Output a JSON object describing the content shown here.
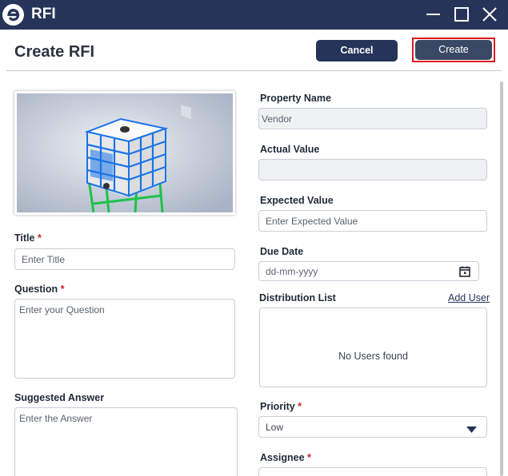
{
  "window": {
    "title": "RFI",
    "logo_icon": "e-logo-icon",
    "controls": [
      "minimize-icon",
      "maximize-icon",
      "close-icon"
    ]
  },
  "header": {
    "page_title": "Create RFI",
    "cancel_label": "Cancel",
    "create_label": "Create"
  },
  "left": {
    "title": {
      "label": "Title",
      "required": "*",
      "placeholder": "Enter Title"
    },
    "question": {
      "label": "Question",
      "required": "*",
      "placeholder": "Enter your Question"
    },
    "suggested_answer": {
      "label": "Suggested Answer",
      "placeholder": "Enter the Answer"
    }
  },
  "right": {
    "property_name": {
      "label": "Property Name",
      "value": "Vendor"
    },
    "actual_value": {
      "label": "Actual Value",
      "value": ""
    },
    "expected_value": {
      "label": "Expected Value",
      "placeholder": "Enter Expected Value"
    },
    "due_date": {
      "label": "Due Date",
      "placeholder": "dd-mm-yyyy",
      "icon": "calendar-icon"
    },
    "distribution_list": {
      "label": "Distribution List",
      "add_user": "Add User",
      "empty_message": "No Users found"
    },
    "priority": {
      "label": "Priority",
      "required": "*",
      "value": "Low",
      "icon": "caret-down-icon"
    },
    "assignee": {
      "label": "Assignee",
      "required": "*"
    }
  },
  "colors": {
    "titlebar": "#26345a",
    "primary_button": "#26345a",
    "highlight_border": "#e0161f",
    "required": "#d0202a"
  }
}
